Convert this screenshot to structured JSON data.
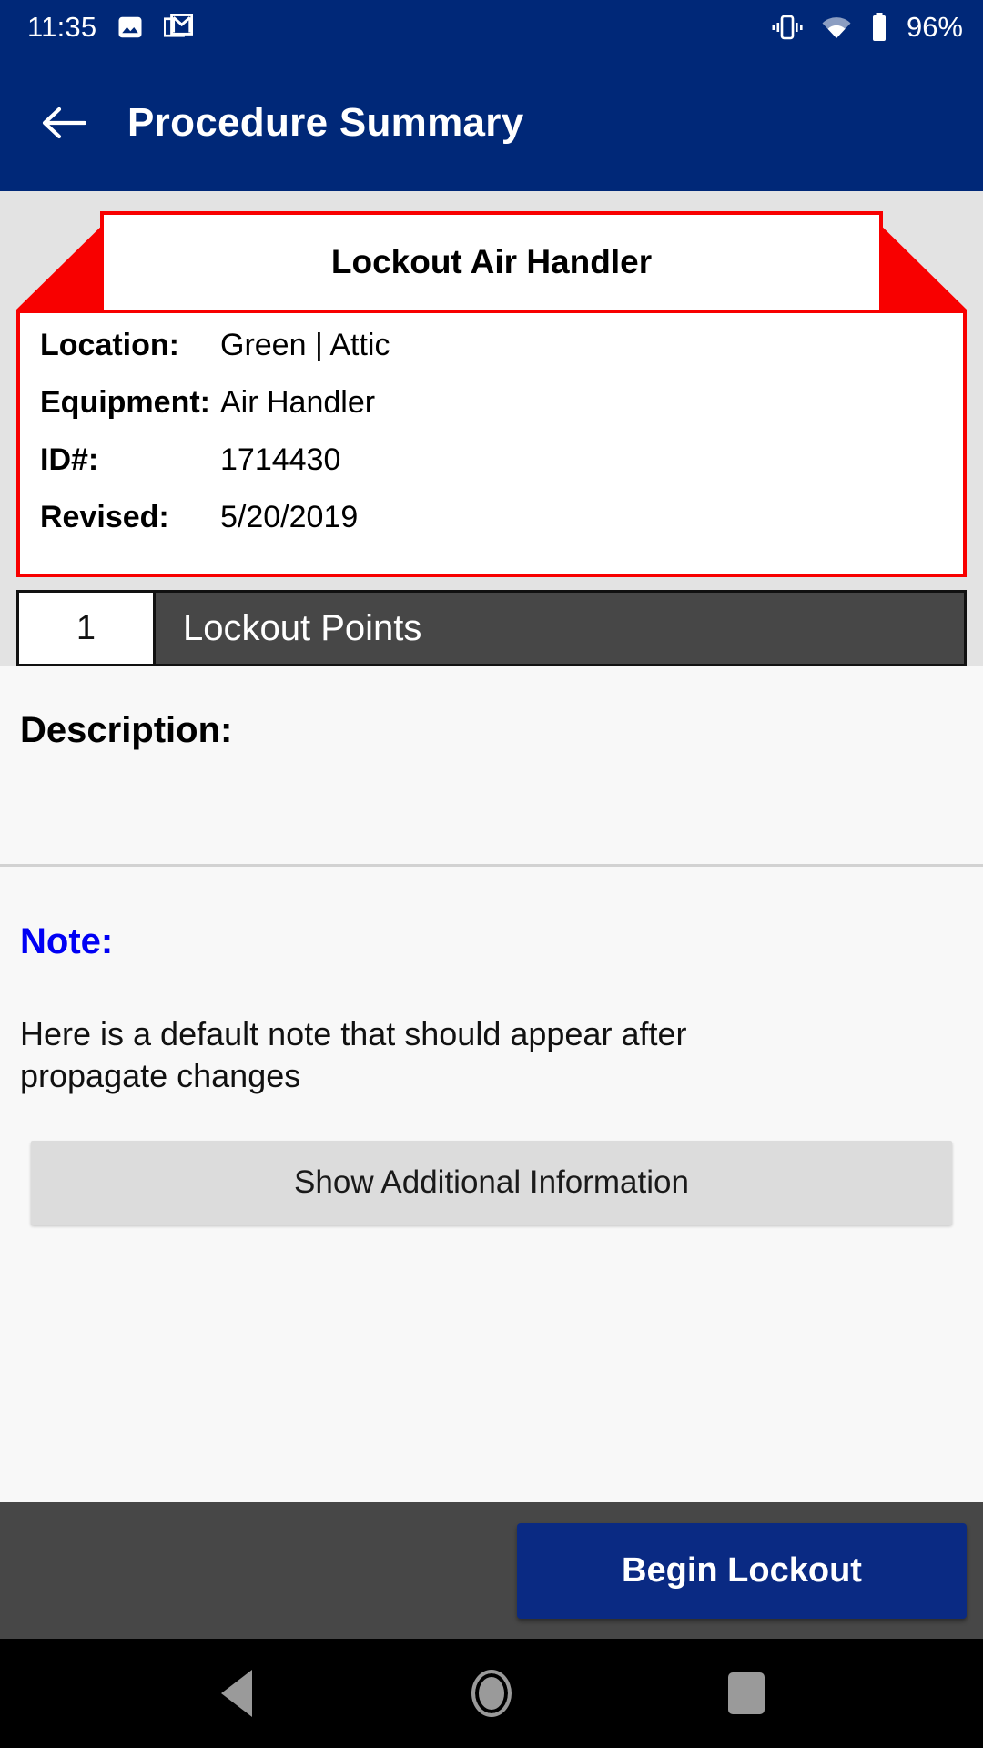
{
  "status_bar": {
    "time": "11:35",
    "battery_percent": "96%",
    "left_icons": [
      "photos-icon",
      "gmail-icon"
    ],
    "right_icons": [
      "vibrate-icon",
      "wifi-icon",
      "battery-icon"
    ]
  },
  "app_bar": {
    "back_icon": "back-arrow-icon",
    "title": "Procedure Summary"
  },
  "procedure_tag": {
    "title": "Lockout Air Handler",
    "accent_color": "#f80000",
    "details": [
      {
        "label": "Location:",
        "value": "Green | Attic"
      },
      {
        "label": "Equipment:",
        "value": "Air Handler"
      },
      {
        "label": "ID#:",
        "value": "1714430"
      },
      {
        "label": "Revised:",
        "value": "5/20/2019"
      }
    ]
  },
  "lockout_points": {
    "count": "1",
    "label": "Lockout Points"
  },
  "description": {
    "heading": "Description:",
    "body": ""
  },
  "note": {
    "heading": "Note:",
    "heading_color": "#0000f4",
    "body": "Here is a default note that should appear after propagate changes"
  },
  "additional_info": {
    "label": "Show Additional Information"
  },
  "action_bar": {
    "primary_label": "Begin Lockout",
    "primary_color": "#0a2a83"
  },
  "nav_bar": {
    "back": "nav-back-icon",
    "home": "nav-home-icon",
    "recents": "nav-recents-icon"
  }
}
